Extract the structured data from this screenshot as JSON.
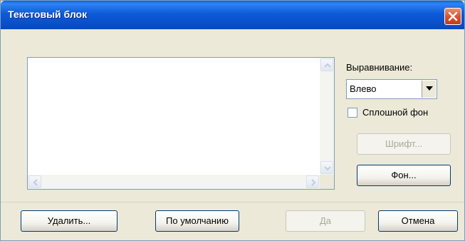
{
  "window": {
    "title": "Текстовый блок"
  },
  "textarea": {
    "value": ""
  },
  "alignment": {
    "label": "Выравнивание:",
    "selected": "Влево"
  },
  "solid_background": {
    "label": "Сплошной фон",
    "checked": false
  },
  "buttons": {
    "font": "Шрифт...",
    "background": "Фон...",
    "delete": "Удалить...",
    "default": "По умолчанию",
    "ok": "Да",
    "cancel": "Отмена"
  },
  "icons": {
    "close": "close-icon",
    "scroll_up": "arrow-up-icon",
    "scroll_down": "arrow-down-icon",
    "scroll_left": "arrow-left-icon",
    "scroll_right": "arrow-right-icon",
    "dropdown": "chevron-down-icon"
  },
  "colors": {
    "titlebar": "#0a4fc9",
    "close_button": "#d9542e",
    "dialog_bg": "#ece9d8"
  }
}
